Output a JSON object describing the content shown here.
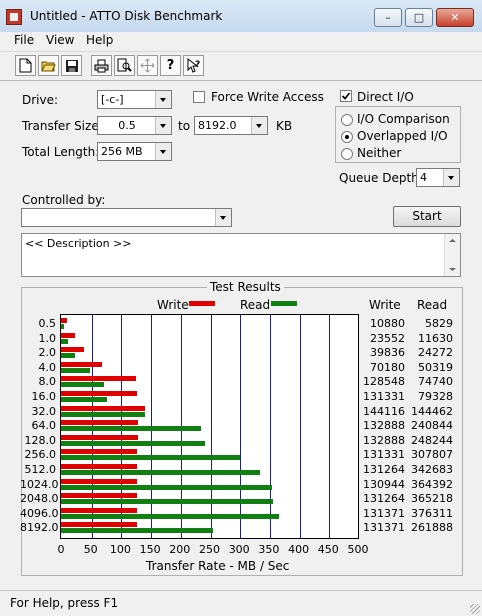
{
  "window": {
    "title": "Untitled - ATTO Disk Benchmark"
  },
  "menu": [
    "File",
    "View",
    "Help"
  ],
  "toolbar_icons": [
    "new-file-icon",
    "open-folder-icon",
    "save-icon",
    "print-icon",
    "print-preview-icon",
    "move-icon",
    "help-icon",
    "context-help-icon"
  ],
  "form": {
    "drive_label": "Drive:",
    "drive_value": "[-c-]",
    "force_write_label": "Force Write Access",
    "force_write_checked": false,
    "direct_io_label": "Direct I/O",
    "direct_io_checked": true,
    "transfer_size_label": "Transfer Size:",
    "transfer_from": "0.5",
    "to_label": "to",
    "transfer_to": "8192.0",
    "kb_label": "KB",
    "total_length_label": "Total Length:",
    "total_length_value": "256 MB",
    "io_options": [
      "I/O Comparison",
      "Overlapped I/O",
      "Neither"
    ],
    "io_selected": "Overlapped I/O",
    "queue_depth_label": "Queue Depth:",
    "queue_depth_value": "4",
    "controlled_by_label": "Controlled by:",
    "controlled_by_value": "",
    "start_label": "Start",
    "description": "<< Description >>"
  },
  "results": {
    "title": "Test Results",
    "legend_write": "Write",
    "legend_read": "Read",
    "col_write": "Write",
    "col_read": "Read",
    "axis_label": "Transfer Rate - MB / Sec"
  },
  "chart_data": {
    "type": "bar",
    "orientation": "horizontal",
    "title": "Test Results",
    "xlabel": "Transfer Rate - MB / Sec",
    "xlim": [
      0,
      500
    ],
    "xticks": [
      "0",
      "50",
      "100",
      "150",
      "200",
      "250",
      "300",
      "350",
      "400",
      "450",
      "500"
    ],
    "categories": [
      "0.5",
      "1.0",
      "2.0",
      "4.0",
      "8.0",
      "16.0",
      "32.0",
      "64.0",
      "128.0",
      "256.0",
      "512.0",
      "1024.0",
      "2048.0",
      "4096.0",
      "8192.0"
    ],
    "series": [
      {
        "name": "Write",
        "color": "#e00000",
        "values": [
          10880,
          23552,
          39836,
          70180,
          128548,
          131331,
          144116,
          132888,
          132888,
          131331,
          131264,
          130944,
          131264,
          131371,
          131371
        ]
      },
      {
        "name": "Read",
        "color": "#108010",
        "values": [
          5829,
          11630,
          24272,
          50319,
          74740,
          79328,
          144462,
          240844,
          248244,
          307807,
          342683,
          364392,
          365218,
          376311,
          261888
        ]
      }
    ]
  },
  "status": {
    "text": "For Help, press F1"
  }
}
